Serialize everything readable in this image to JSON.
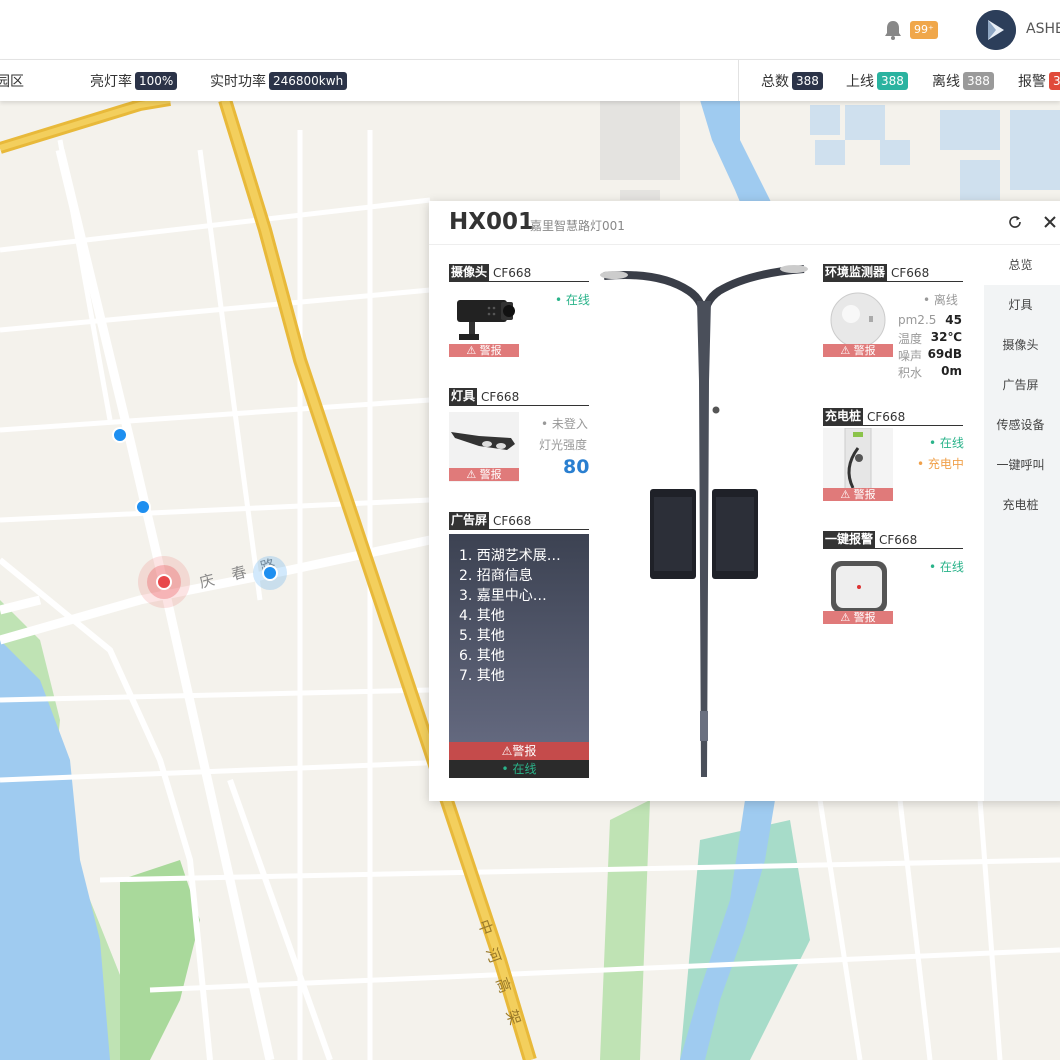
{
  "header": {
    "notification_count": "99⁺",
    "user_name": "ASHE"
  },
  "stats": {
    "area_label": "园区",
    "light_rate_label": "亮灯率",
    "light_rate_value": "100%",
    "power_label": "实时功率",
    "power_value": "246800kwh",
    "total_label": "总数",
    "total_value": "388",
    "online_label": "上线",
    "online_value": "388",
    "offline_label": "离线",
    "offline_value": "388",
    "alarm_label": "报警",
    "alarm_value": "3"
  },
  "map": {
    "road_qingchun": [
      "庆",
      "春",
      "路"
    ],
    "road_zhonghe": [
      "中",
      "河",
      "高",
      "架"
    ],
    "marker_colors": {
      "alarm": "#e8474b",
      "normal": "#1e8ff0"
    }
  },
  "panel": {
    "title": "HX001",
    "subtitle": "嘉里智慧路灯001",
    "tabs": [
      "总览",
      "灯具",
      "摄像头",
      "广告屏",
      "传感设备",
      "一键呼叫",
      "充电桩"
    ],
    "alarm_label": "⚠ 警报",
    "camera": {
      "name": "摄像头",
      "code": "CF668",
      "status": "• 在线"
    },
    "lamp": {
      "name": "灯具",
      "code": "CF668",
      "status": "• 未登入",
      "intensity_label": "灯光强度",
      "intensity_value": "80"
    },
    "ad_screen": {
      "name": "广告屏",
      "code": "CF668",
      "items": [
        "1. 西湖艺术展…",
        "2. 招商信息",
        "3. 嘉里中心…",
        "4. 其他",
        "5. 其他",
        "6. 其他",
        "7. 其他"
      ],
      "alarm": "⚠警报",
      "status": "• 在线"
    },
    "env_monitor": {
      "name": "环境监测器",
      "code": "CF668",
      "status": "• 离线",
      "rows": [
        {
          "key": "pm2.5",
          "value": "45"
        },
        {
          "key": "温度",
          "value": "32℃"
        },
        {
          "key": "噪声",
          "value": "69dB"
        },
        {
          "key": "积水",
          "value": "0m"
        }
      ]
    },
    "charger": {
      "name": "充电桩",
      "code": "CF668",
      "status": "• 在线",
      "charging": "• 充电中"
    },
    "sos": {
      "name": "一键报警",
      "code": "CF668",
      "status": "• 在线"
    }
  }
}
